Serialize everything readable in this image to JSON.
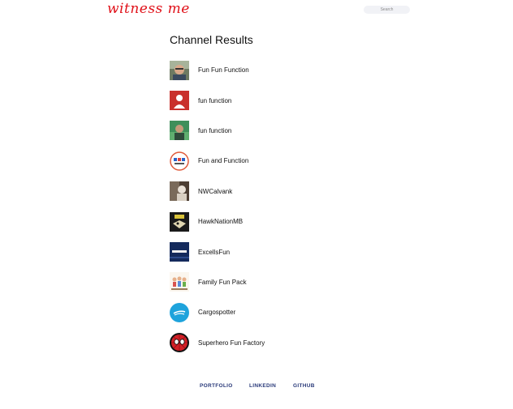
{
  "header": {
    "logo_text": "witness me",
    "search_placeholder": "Search"
  },
  "page_title": "Channel Results",
  "channels": [
    {
      "name": "Fun Fun Function",
      "avatar_icon": "person-photo-icon"
    },
    {
      "name": "fun function",
      "avatar_icon": "default-user-icon"
    },
    {
      "name": "fun function",
      "avatar_icon": "green-photo-icon"
    },
    {
      "name": "Fun and Function",
      "avatar_icon": "funandfunction-logo-icon"
    },
    {
      "name": "NWCalvank",
      "avatar_icon": "photo-icon"
    },
    {
      "name": "HawkNationMB",
      "avatar_icon": "hawk-logo-icon"
    },
    {
      "name": "ExcellsFun",
      "avatar_icon": "excelisfun-logo-icon"
    },
    {
      "name": "Family Fun Pack",
      "avatar_icon": "family-cartoon-icon"
    },
    {
      "name": "Cargospotter",
      "avatar_icon": "ship-logo-icon"
    },
    {
      "name": "Superhero Fun Factory",
      "avatar_icon": "spiderman-icon"
    }
  ],
  "footer": {
    "links": [
      "PORTFOLIO",
      "LINKEDIN",
      "GITHUB"
    ]
  },
  "colors": {
    "logo": "#e0121a",
    "footer_link": "#2a3a7a",
    "search_bg": "#f1f2f6"
  }
}
